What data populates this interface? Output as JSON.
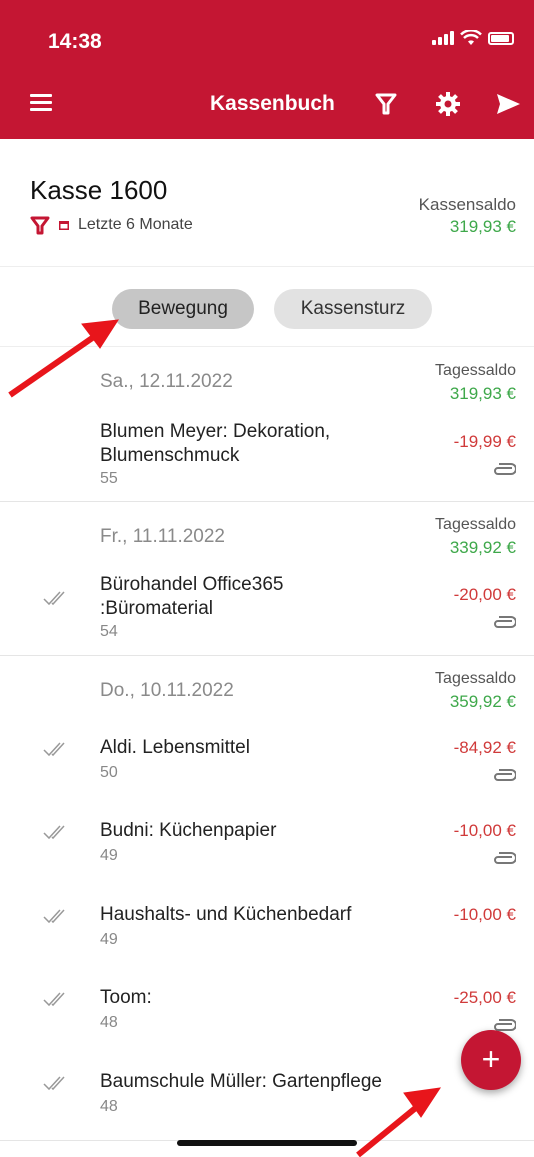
{
  "status": {
    "time": "14:38"
  },
  "toolbar": {
    "title": "Kassenbuch"
  },
  "header": {
    "kasse": "Kasse 1600",
    "period": "Letzte 6 Monate",
    "saldo_label": "Kassensaldo",
    "saldo_value": "319,93 €"
  },
  "tabs": [
    {
      "label": "Bewegung",
      "active": true
    },
    {
      "label": "Kassensturz",
      "active": false
    }
  ],
  "days": [
    {
      "date": "Sa., 12.11.2022",
      "saldo_label": "Tagessaldo",
      "saldo": "319,93 €"
    },
    {
      "date": "Fr., 11.11.2022",
      "saldo_label": "Tagessaldo",
      "saldo": "339,92 €"
    },
    {
      "date": "Do., 10.11.2022",
      "saldo_label": "Tagessaldo",
      "saldo": "359,92 €"
    }
  ],
  "entries": [
    {
      "title": "Blumen Meyer: Dekoration, Blumenschmuck",
      "number": "55",
      "amount": "-19,99 €",
      "checked": false,
      "attachment": true
    },
    {
      "title": " Bürohandel Office365 :Büromaterial",
      "number": "54",
      "amount": "-20,00 €",
      "checked": true,
      "attachment": true
    },
    {
      "title": "Aldi. Lebensmittel",
      "number": "50",
      "amount": "-84,92 €",
      "checked": true,
      "attachment": true
    },
    {
      "title": "Budni: Küchenpapier",
      "number": "49",
      "amount": "-10,00 €",
      "checked": true,
      "attachment": true
    },
    {
      "title": "Haushalts- und Küchenbedarf",
      "number": "49",
      "amount": "-10,00 €",
      "checked": true,
      "attachment": false
    },
    {
      "title": "Toom:",
      "number": "48",
      "amount": "-25,00 €",
      "checked": true,
      "attachment": true
    },
    {
      "title": "Baumschule Müller: Gartenpflege",
      "number": "48",
      "amount": "",
      "checked": true,
      "attachment": false
    }
  ],
  "fab": {
    "label": "+"
  },
  "colors": {
    "brand": "#c41633",
    "positive": "#3ea84a",
    "negative": "#d03a3a",
    "annotation_arrow": "#e8151b"
  }
}
